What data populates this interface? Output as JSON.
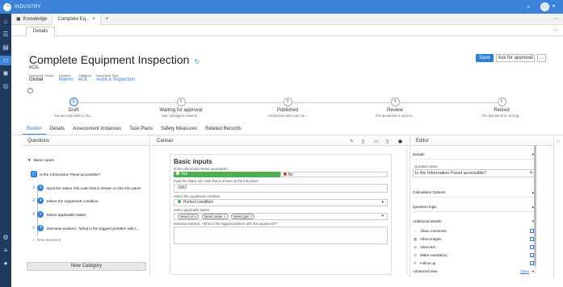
{
  "app": {
    "brand": "INDUSTRY"
  },
  "window_tabs": [
    {
      "label": "Knowledge"
    },
    {
      "label": "Complete Eq..."
    }
  ],
  "subtab": {
    "label": "Details"
  },
  "doc": {
    "title": "Complete Equipment Inspection",
    "subtitle": "eCIL",
    "meta": [
      {
        "key": "Document Scope",
        "value": "Global",
        "link": false
      },
      {
        "key": "Location",
        "value": "Malmo",
        "link": true
      },
      {
        "key": "Category",
        "value": "eCIL",
        "link": true
      },
      {
        "key": "Document Type",
        "value": "Audit & Inspection",
        "link": true
      }
    ]
  },
  "actions": {
    "save": "Save",
    "approval": "Ask for approval",
    "more": "..."
  },
  "steps": [
    {
      "num": "1",
      "label": "Draft",
      "desc": "You are now able to cha..."
    },
    {
      "num": "2",
      "label": "Waiting for approval",
      "desc": "Your colleagues need to ..."
    },
    {
      "num": "3",
      "label": "Published",
      "desc": "Authorized users can vie..."
    },
    {
      "num": "4",
      "label": "Review",
      "desc": "The document is current..."
    },
    {
      "num": "5",
      "label": "Retired",
      "desc": "The document is no long..."
    }
  ],
  "nav_tabs": [
    "Builder",
    "Details",
    "Assessment Instances",
    "Task Plans",
    "Safety Measures",
    "Related Records"
  ],
  "questions": {
    "header": "Questions",
    "group": "Basic inputs",
    "items": [
      "Is the Information Panel accessible?",
      "Input the status info code that is shown on the info panel",
      "Select the equipment condition",
      "Select applicable states",
      "Interview workers: \"What is the biggest problem with t..."
    ],
    "new_question": "New Question",
    "new_category": "New Category"
  },
  "canvas": {
    "header": "Canvas",
    "section": "Basic inputs",
    "q1_label": "Is the Information Panel accessible?",
    "yes": "Yes",
    "no": "No",
    "q2_label": "Input the status info code that is shown on the info panel",
    "q2_value": "1002",
    "q3_label": "Select the equipment condition",
    "q3_value": "Perfect condition",
    "q4_label": "Select applicable states",
    "chips": [
      "Need oil",
      "Need water",
      "Need gas"
    ],
    "q5_label": "Interview workers: \"What is the biggest problem with this equipment?\""
  },
  "editor": {
    "header": "Editor",
    "details": "Details",
    "qname_label": "Question name",
    "qname_value": "Is the Information Panel accessible?",
    "calc": "Calculation Options",
    "logic": "Question logic",
    "additional": "Additional details",
    "options": [
      "Allow comments",
      "Allow images",
      "Allow N/A",
      "Make mandatory",
      "Follow up"
    ],
    "advanced": "Advanced view",
    "advanced_link": "Open"
  }
}
